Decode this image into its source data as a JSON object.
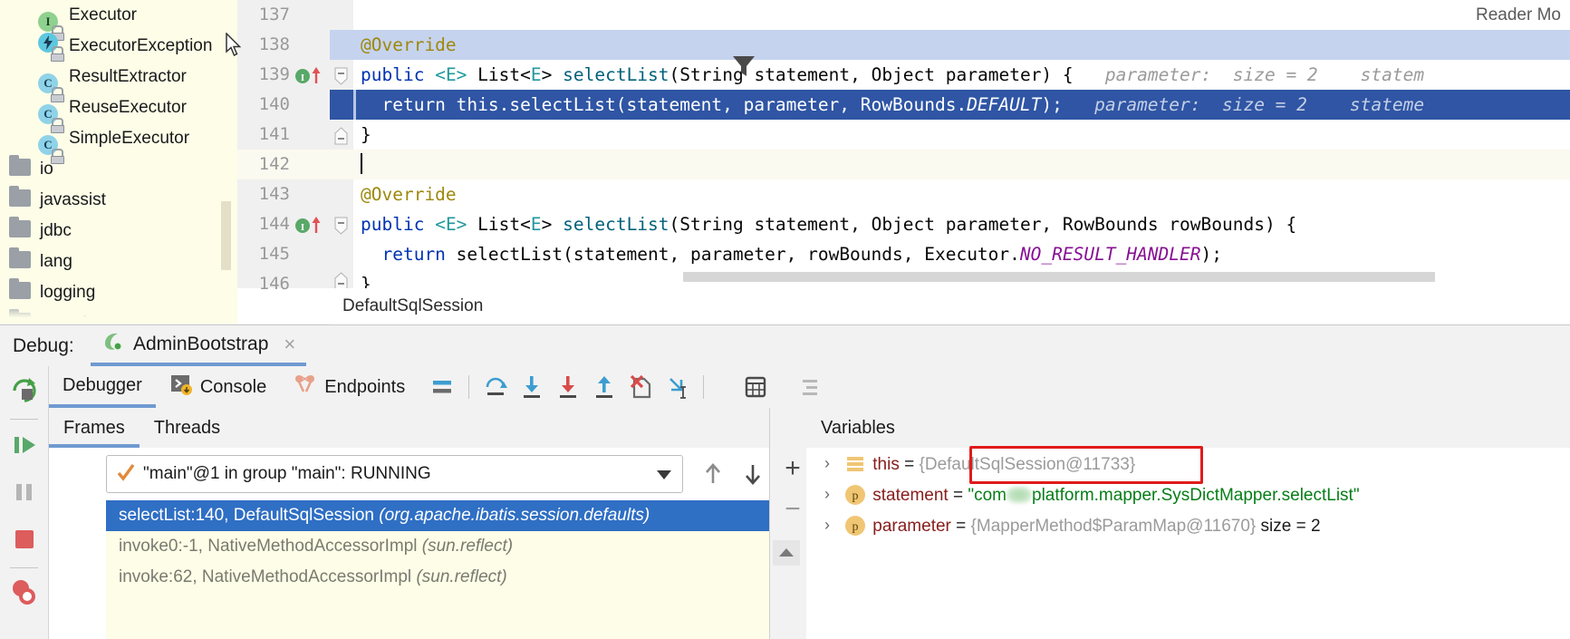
{
  "editor": {
    "reader_mode_label": "Reader Mo",
    "breadcrumb": "DefaultSqlSession",
    "lines": [
      {
        "num": "137",
        "text": ""
      },
      {
        "num": "138",
        "text": "@Override"
      },
      {
        "num": "139",
        "text": "public <E> List<E> selectList(String statement, Object parameter) {"
      },
      {
        "num": "140",
        "text": "return this.selectList(statement, parameter, RowBounds.DEFAULT);"
      },
      {
        "num": "141",
        "text": "}"
      },
      {
        "num": "142",
        "text": ""
      },
      {
        "num": "143",
        "text": "@Override"
      },
      {
        "num": "144",
        "text": "public <E> List<E> selectList(String statement, Object parameter, RowBounds rowBounds) {"
      },
      {
        "num": "145",
        "text": "return selectList(statement, parameter, rowBounds, Executor.NO_RESULT_HANDLER);"
      },
      {
        "num": "146",
        "text": "}"
      }
    ],
    "tokens": {
      "annotation": "@Override",
      "kw_public": "public",
      "kw_return": "return",
      "generic_open": "<E>",
      "type_list": "List<E>",
      "method_selectList": "selectList",
      "type_string": "String",
      "type_object": "Object",
      "type_rowbounds": "RowBounds",
      "arg_statement": "statement",
      "arg_parameter": "parameter",
      "arg_rowbounds": "rowBounds",
      "this_kw": "this",
      "const_default": "DEFAULT",
      "class_executor": "Executor",
      "const_no_result_handler": "NO_RESULT_HANDLER"
    },
    "inline_hints": {
      "parameter_hint": "parameter:  size = 2",
      "statement_hint_139": "statem",
      "statement_hint_140": "stateme"
    }
  },
  "project_tree": {
    "items": [
      {
        "label": "Executor",
        "icon": "interface-icon",
        "level": 2
      },
      {
        "label": "ExecutorException",
        "icon": "exception-class-icon",
        "level": 2
      },
      {
        "label": "ResultExtractor",
        "icon": "class-icon",
        "level": 2
      },
      {
        "label": "ReuseExecutor",
        "icon": "class-icon",
        "level": 2
      },
      {
        "label": "SimpleExecutor",
        "icon": "class-icon",
        "level": 2
      },
      {
        "label": "io",
        "icon": "folder-icon",
        "level": 1
      },
      {
        "label": "javassist",
        "icon": "folder-icon",
        "level": 1
      },
      {
        "label": "jdbc",
        "icon": "folder-icon",
        "level": 1
      },
      {
        "label": "lang",
        "icon": "folder-icon",
        "level": 1
      },
      {
        "label": "logging",
        "icon": "folder-icon",
        "level": 1
      },
      {
        "label": "mapping",
        "icon": "folder-icon",
        "level": 1
      }
    ]
  },
  "debug_window": {
    "label": "Debug:",
    "tab_title": "AdminBootstrap",
    "close_label": "×",
    "tabs": [
      {
        "label": "Debugger",
        "icon": "debugger-icon",
        "active": true
      },
      {
        "label": "Console",
        "icon": "console-icon",
        "active": false
      },
      {
        "label": "Endpoints",
        "icon": "endpoints-icon",
        "active": false
      }
    ],
    "toolbar_icons": [
      "layout-settings-icon",
      "step-over-icon",
      "step-into-icon",
      "force-step-into-icon",
      "step-out-icon",
      "drop-frame-icon",
      "run-to-cursor-icon",
      "evaluate-expression-icon",
      "mute-breakpoints-icon"
    ],
    "rail_icons": [
      "rerun-icon",
      "resume-program-icon",
      "pause-program-icon",
      "stop-icon",
      "view-breakpoints-icon"
    ]
  },
  "frames": {
    "tabs": [
      {
        "label": "Frames",
        "active": true
      },
      {
        "label": "Threads",
        "active": false
      }
    ],
    "thread_selector": {
      "value": "\"main\"@1 in group \"main\": RUNNING",
      "status_icon": "check-icon"
    },
    "nav_icons": [
      "frame-up-icon",
      "frame-down-icon",
      "filter-icon"
    ],
    "stack": [
      {
        "method": "selectList:140, DefaultSqlSession",
        "package": "(org.apache.ibatis.session.defaults)",
        "selected": true
      },
      {
        "method": "invoke0:-1, NativeMethodAccessorImpl",
        "package": "(sun.reflect)",
        "selected": false
      },
      {
        "method": "invoke:62, NativeMethodAccessorImpl",
        "package": "(sun.reflect)",
        "selected": false
      }
    ]
  },
  "variables": {
    "title": "Variables",
    "add_label": "+",
    "remove_label": "−",
    "rows": [
      {
        "chevron": "›",
        "icon": "object-value-icon",
        "name": "this",
        "eq": " = ",
        "value": "{DefaultSqlSession@11733}",
        "value_kind": "ref",
        "highlighted": true
      },
      {
        "chevron": "›",
        "icon": "parameter-icon",
        "name": "statement",
        "eq": " = ",
        "value_prefix": "\"com",
        "value_suffix": "platform.mapper.SysDictMapper.selectList\"",
        "value_kind": "string",
        "redacted": true,
        "highlighted": false
      },
      {
        "chevron": "›",
        "icon": "parameter-icon",
        "name": "parameter",
        "eq": " = ",
        "value": "{MapperMethod$ParamMap@11670}",
        "value_suffix_plain": "  size = 2",
        "value_kind": "ref",
        "highlighted": false
      }
    ]
  },
  "colors": {
    "accent_blue": "#2f6fc4",
    "selection_blue": "#c5d3ee",
    "exec_line_blue": "#2f55a4",
    "annotation_red": "#e01b1b",
    "tree_bg": "#fdfde8",
    "keyword": "#0033b3",
    "string_green": "#067d17",
    "static_field": "#871094"
  }
}
